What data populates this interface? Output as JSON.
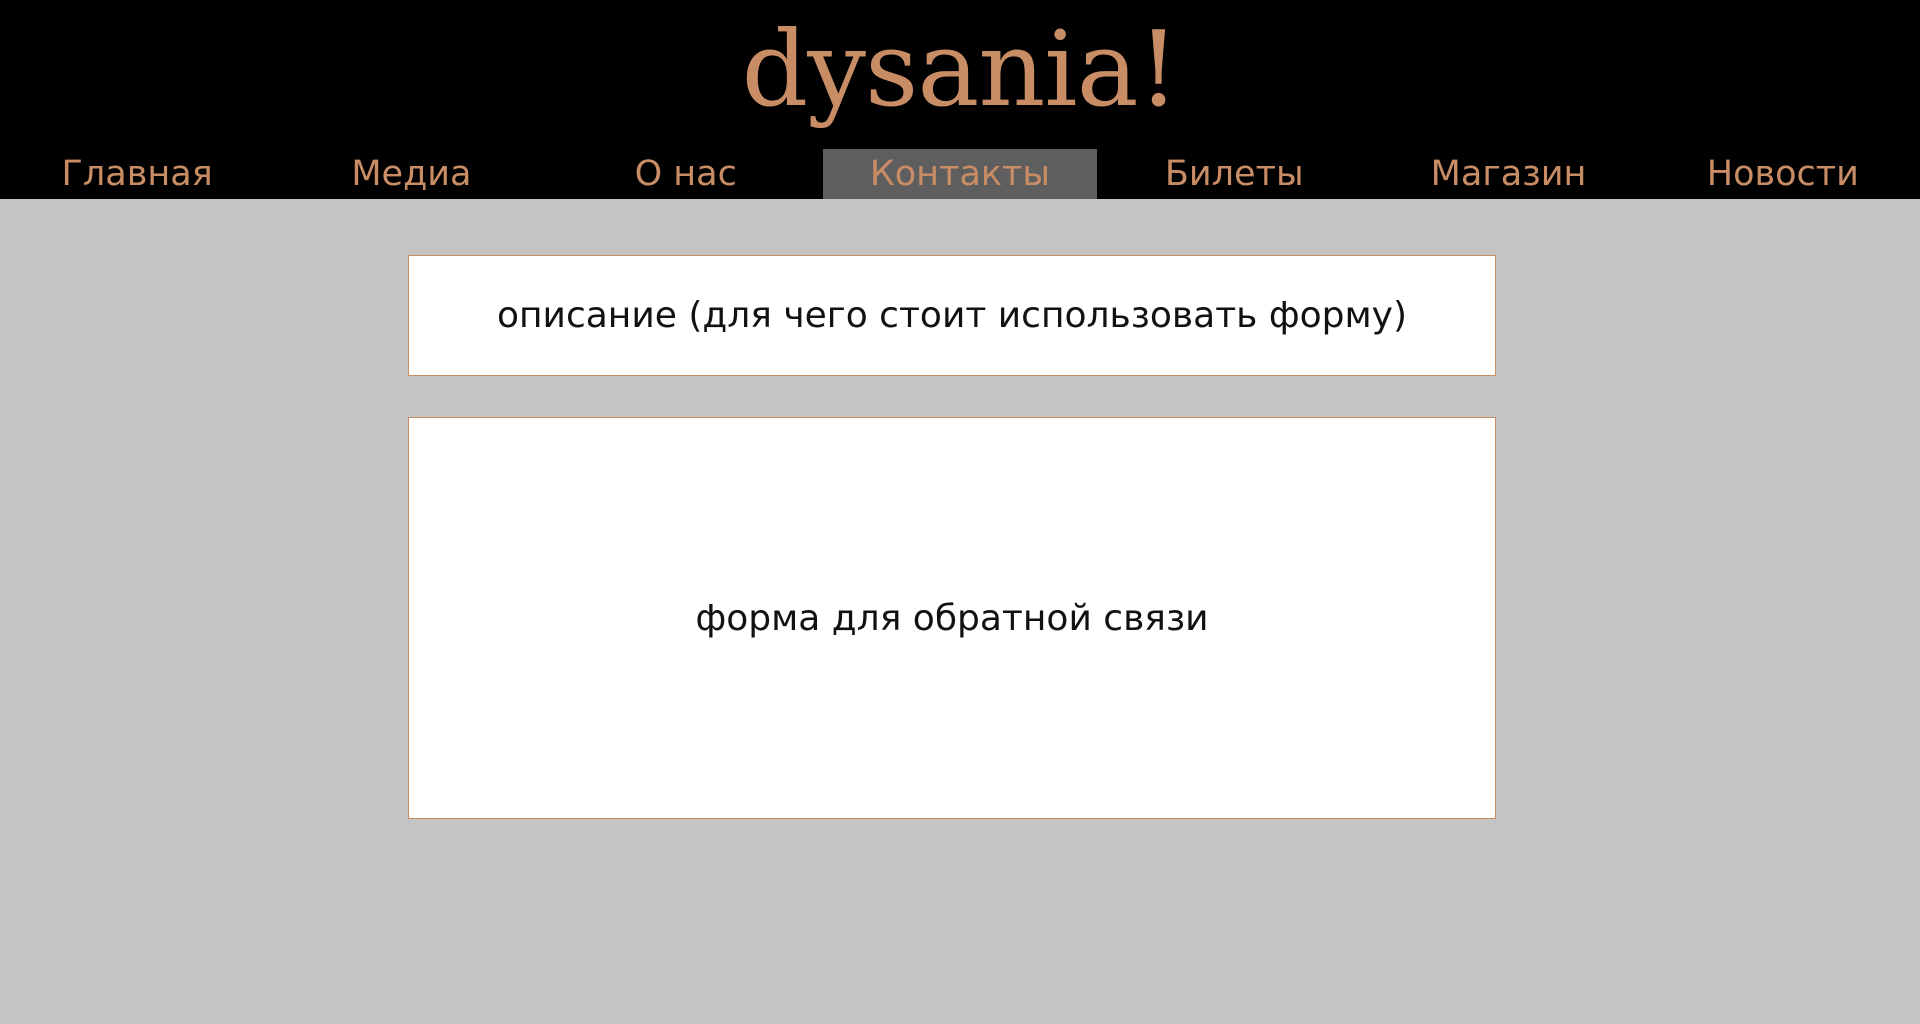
{
  "header": {
    "logo_text": "dysania!"
  },
  "nav": {
    "items": [
      {
        "label": "Главная",
        "active": false
      },
      {
        "label": "Медиа",
        "active": false
      },
      {
        "label": "О нас",
        "active": false
      },
      {
        "label": "Контакты",
        "active": true
      },
      {
        "label": "Билеты",
        "active": false
      },
      {
        "label": "Магазин",
        "active": false
      },
      {
        "label": "Новости",
        "active": false
      }
    ]
  },
  "main": {
    "description_text": "описание (для чего стоит использовать форму)",
    "form_text": "форма для обратной связи"
  },
  "colors": {
    "header_bg": "#000000",
    "accent": "#c98d66",
    "active_tab_bg": "#5e5e5e",
    "page_bg": "#c4c4c4",
    "panel_bg": "#ffffff"
  }
}
